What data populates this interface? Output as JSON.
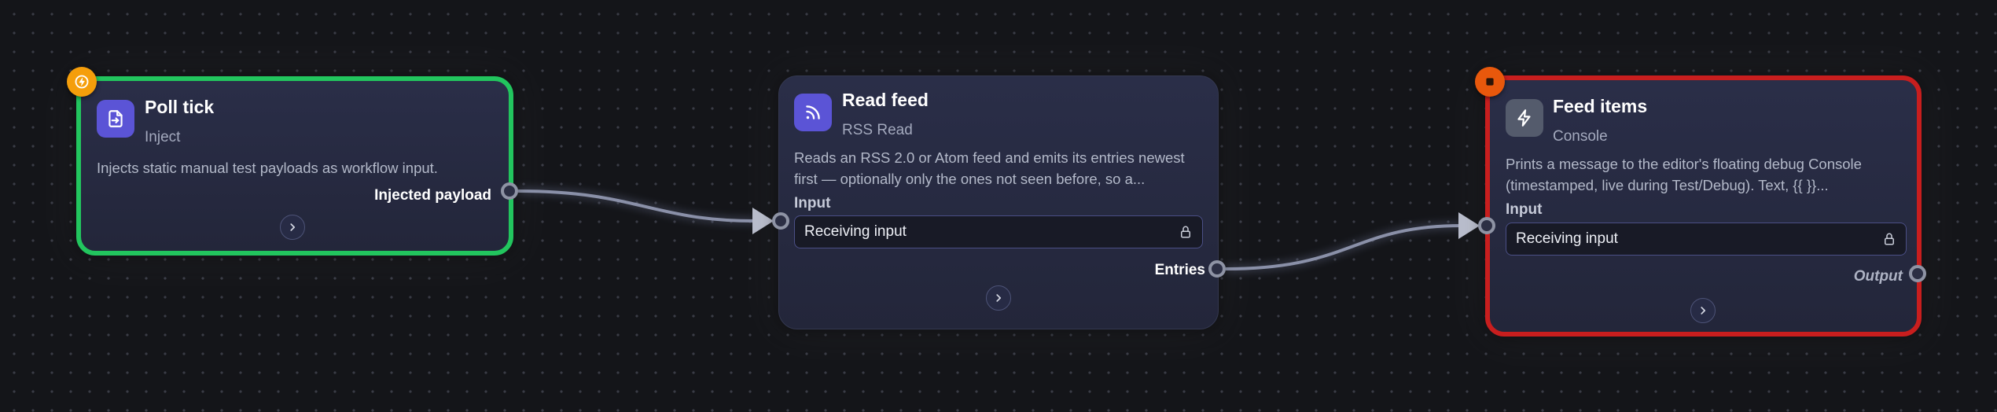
{
  "nodes": {
    "inject": {
      "title": "Poll tick",
      "type": "Inject",
      "description": "Injects static manual test payloads as workflow input.",
      "output_label": "Injected payload",
      "icon": "file-import-icon",
      "badge_icon": "lightning-icon",
      "status_color": "#22c55e"
    },
    "rss": {
      "title": "Read feed",
      "type": "RSS Read",
      "description": "Reads an RSS 2.0 or Atom feed and emits its entries newest first — optionally only the ones not seen before, so a...",
      "input_label": "Input",
      "input_value": "Receiving input",
      "output_label": "Entries",
      "icon": "rss-icon"
    },
    "console": {
      "title": "Feed items",
      "type": "Console",
      "description": "Prints a message to the editor's floating debug Console (timestamped, live during Test/Debug). Text, {{ }}...",
      "input_label": "Input",
      "input_value": "Receiving input",
      "output_label": "Output",
      "icon": "lightning-icon",
      "badge_icon": "stop-icon",
      "status_color": "#c81e1e"
    }
  },
  "colors": {
    "accent": "#5b54d6",
    "success": "#22c55e",
    "error": "#c81e1e",
    "trigger_badge": "#f59e0b",
    "stop_badge": "#e8580c",
    "edge": "#8a90a8"
  }
}
